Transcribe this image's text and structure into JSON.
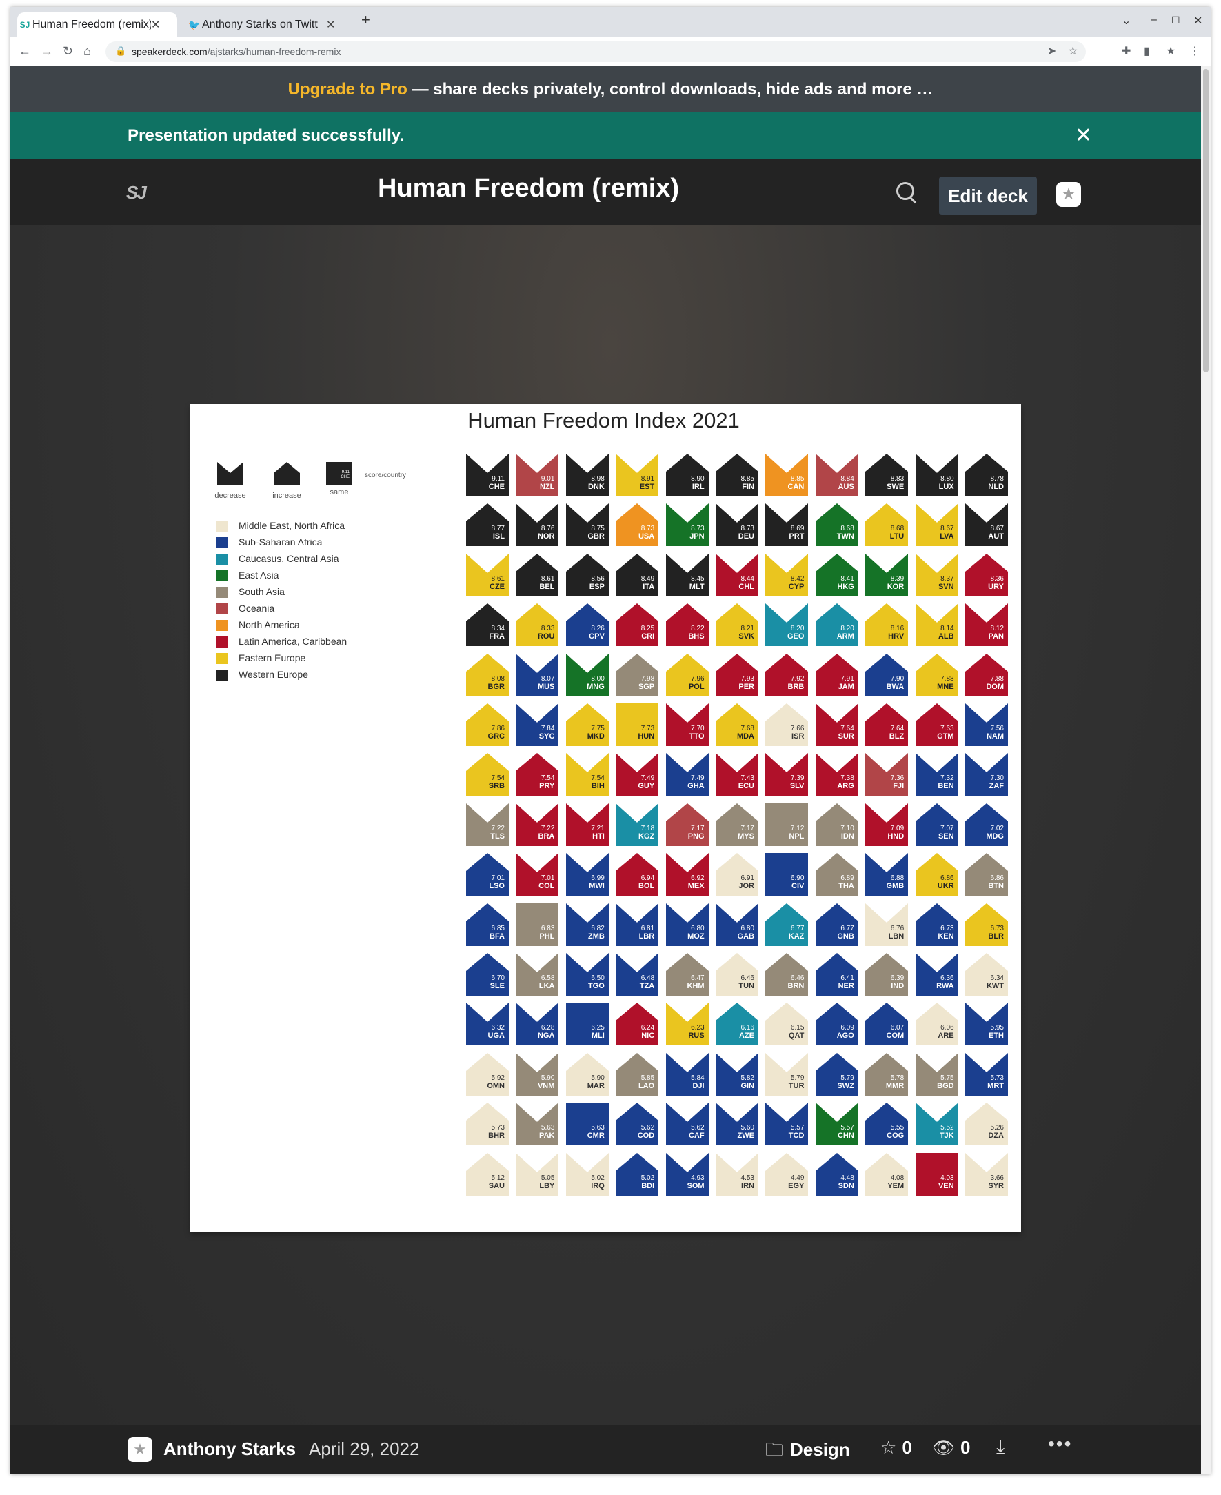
{
  "browser": {
    "tabs": [
      {
        "title": "Human Freedom (remix)",
        "favicon": "speakerdeck-favicon",
        "active": true
      },
      {
        "title": "Anthony Starks on Twitt",
        "favicon": "twitter-favicon",
        "active": false
      }
    ],
    "url_host": "speakerdeck.com",
    "url_path": "/ajstarks/human-freedom-remix"
  },
  "promo": {
    "highlight": "Upgrade to Pro",
    "rest": " — share decks privately, control downloads, hide ads and more …"
  },
  "flash": {
    "message": "Presentation updated successfully."
  },
  "header": {
    "logo": "SJ",
    "title": "Human Freedom (remix)",
    "edit_label": "Edit deck"
  },
  "slide": {
    "title": "Human Freedom Index 2021",
    "key": [
      {
        "shape": "decrease",
        "label": "decrease"
      },
      {
        "shape": "increase",
        "label": "increase"
      },
      {
        "shape": "same",
        "label": "same",
        "sample_score": "9.11",
        "sample_code": "CHE"
      }
    ],
    "key_note": "score/country",
    "legend": [
      {
        "name": "Middle East, North Africa",
        "color": "#efe6cf"
      },
      {
        "name": "Sub-Saharan Africa",
        "color": "#1b3f8f"
      },
      {
        "name": "Caucasus, Central Asia",
        "color": "#1a8fa5"
      },
      {
        "name": "East Asia",
        "color": "#157327"
      },
      {
        "name": "South Asia",
        "color": "#958a78"
      },
      {
        "name": "Oceania",
        "color": "#b14548"
      },
      {
        "name": "North America",
        "color": "#ef9321"
      },
      {
        "name": "Latin America, Caribbean",
        "color": "#b0112a"
      },
      {
        "name": "Eastern Europe",
        "color": "#eac51f"
      },
      {
        "name": "Western Europe",
        "color": "#222222"
      }
    ]
  },
  "chart_data": {
    "type": "table",
    "title": "Human Freedom Index 2021",
    "rows": [
      [
        [
          "9.11",
          "CHE",
          "W",
          "d"
        ],
        [
          "9.01",
          "NZL",
          "O",
          "d"
        ],
        [
          "8.98",
          "DNK",
          "W",
          "d"
        ],
        [
          "8.91",
          "EST",
          "E",
          "d"
        ],
        [
          "8.90",
          "IRL",
          "W",
          "i"
        ],
        [
          "8.85",
          "FIN",
          "W",
          "i"
        ],
        [
          "8.85",
          "CAN",
          "N",
          "d"
        ],
        [
          "8.84",
          "AUS",
          "O",
          "d"
        ],
        [
          "8.83",
          "SWE",
          "W",
          "i"
        ],
        [
          "8.80",
          "LUX",
          "W",
          "d"
        ],
        [
          "8.78",
          "NLD",
          "W",
          "i"
        ]
      ],
      [
        [
          "8.77",
          "ISL",
          "W",
          "i"
        ],
        [
          "8.76",
          "NOR",
          "W",
          "d"
        ],
        [
          "8.75",
          "GBR",
          "W",
          "d"
        ],
        [
          "8.73",
          "USA",
          "N",
          "i"
        ],
        [
          "8.73",
          "JPN",
          "A",
          "d"
        ],
        [
          "8.73",
          "DEU",
          "W",
          "d"
        ],
        [
          "8.69",
          "PRT",
          "W",
          "d"
        ],
        [
          "8.68",
          "TWN",
          "A",
          "i"
        ],
        [
          "8.68",
          "LTU",
          "E",
          "i"
        ],
        [
          "8.67",
          "LVA",
          "E",
          "d"
        ],
        [
          "8.67",
          "AUT",
          "W",
          "d"
        ]
      ],
      [
        [
          "8.61",
          "CZE",
          "E",
          "d"
        ],
        [
          "8.61",
          "BEL",
          "W",
          "i"
        ],
        [
          "8.56",
          "ESP",
          "W",
          "i"
        ],
        [
          "8.49",
          "ITA",
          "W",
          "i"
        ],
        [
          "8.45",
          "MLT",
          "W",
          "d"
        ],
        [
          "8.44",
          "CHL",
          "L",
          "d"
        ],
        [
          "8.42",
          "CYP",
          "E",
          "d"
        ],
        [
          "8.41",
          "HKG",
          "A",
          "i"
        ],
        [
          "8.39",
          "KOR",
          "A",
          "d"
        ],
        [
          "8.37",
          "SVN",
          "E",
          "d"
        ],
        [
          "8.36",
          "URY",
          "L",
          "i"
        ]
      ],
      [
        [
          "8.34",
          "FRA",
          "W",
          "i"
        ],
        [
          "8.33",
          "ROU",
          "E",
          "i"
        ],
        [
          "8.26",
          "CPV",
          "S",
          "i"
        ],
        [
          "8.25",
          "CRI",
          "L",
          "i"
        ],
        [
          "8.22",
          "BHS",
          "L",
          "i"
        ],
        [
          "8.21",
          "SVK",
          "E",
          "i"
        ],
        [
          "8.20",
          "GEO",
          "C",
          "d"
        ],
        [
          "8.20",
          "ARM",
          "C",
          "i"
        ],
        [
          "8.16",
          "HRV",
          "E",
          "i"
        ],
        [
          "8.14",
          "ALB",
          "E",
          "d"
        ],
        [
          "8.12",
          "PAN",
          "L",
          "d"
        ]
      ],
      [
        [
          "8.08",
          "BGR",
          "E",
          "i"
        ],
        [
          "8.07",
          "MUS",
          "S",
          "d"
        ],
        [
          "8.00",
          "MNG",
          "A",
          "d"
        ],
        [
          "7.98",
          "SGP",
          "H",
          "i"
        ],
        [
          "7.96",
          "POL",
          "E",
          "i"
        ],
        [
          "7.93",
          "PER",
          "L",
          "i"
        ],
        [
          "7.92",
          "BRB",
          "L",
          "i"
        ],
        [
          "7.91",
          "JAM",
          "L",
          "i"
        ],
        [
          "7.90",
          "BWA",
          "S",
          "i"
        ],
        [
          "7.88",
          "MNE",
          "E",
          "i"
        ],
        [
          "7.88",
          "DOM",
          "L",
          "i"
        ]
      ],
      [
        [
          "7.86",
          "GRC",
          "E",
          "i"
        ],
        [
          "7.84",
          "SYC",
          "S",
          "d"
        ],
        [
          "7.75",
          "MKD",
          "E",
          "i"
        ],
        [
          "7.73",
          "HUN",
          "E",
          "s"
        ],
        [
          "7.70",
          "TTO",
          "L",
          "d"
        ],
        [
          "7.68",
          "MDA",
          "E",
          "i"
        ],
        [
          "7.66",
          "ISR",
          "M",
          "i"
        ],
        [
          "7.64",
          "SUR",
          "L",
          "d"
        ],
        [
          "7.64",
          "BLZ",
          "L",
          "i"
        ],
        [
          "7.63",
          "GTM",
          "L",
          "i"
        ],
        [
          "7.56",
          "NAM",
          "S",
          "d"
        ]
      ],
      [
        [
          "7.54",
          "SRB",
          "E",
          "i"
        ],
        [
          "7.54",
          "PRY",
          "L",
          "i"
        ],
        [
          "7.54",
          "BIH",
          "E",
          "d"
        ],
        [
          "7.49",
          "GUY",
          "L",
          "d"
        ],
        [
          "7.49",
          "GHA",
          "S",
          "d"
        ],
        [
          "7.43",
          "ECU",
          "L",
          "d"
        ],
        [
          "7.39",
          "SLV",
          "L",
          "d"
        ],
        [
          "7.38",
          "ARG",
          "L",
          "d"
        ],
        [
          "7.36",
          "FJI",
          "O",
          "d"
        ],
        [
          "7.32",
          "BEN",
          "S",
          "d"
        ],
        [
          "7.30",
          "ZAF",
          "S",
          "d"
        ]
      ],
      [
        [
          "7.22",
          "TLS",
          "H",
          "d"
        ],
        [
          "7.22",
          "BRA",
          "L",
          "d"
        ],
        [
          "7.21",
          "HTI",
          "L",
          "d"
        ],
        [
          "7.18",
          "KGZ",
          "C",
          "d"
        ],
        [
          "7.17",
          "PNG",
          "O",
          "i"
        ],
        [
          "7.17",
          "MYS",
          "H",
          "i"
        ],
        [
          "7.12",
          "NPL",
          "H",
          "s"
        ],
        [
          "7.10",
          "IDN",
          "H",
          "i"
        ],
        [
          "7.09",
          "HND",
          "L",
          "d"
        ],
        [
          "7.07",
          "SEN",
          "S",
          "i"
        ],
        [
          "7.02",
          "MDG",
          "S",
          "i"
        ]
      ],
      [
        [
          "7.01",
          "LSO",
          "S",
          "i"
        ],
        [
          "7.01",
          "COL",
          "L",
          "d"
        ],
        [
          "6.99",
          "MWI",
          "S",
          "d"
        ],
        [
          "6.94",
          "BOL",
          "L",
          "i"
        ],
        [
          "6.92",
          "MEX",
          "L",
          "d"
        ],
        [
          "6.91",
          "JOR",
          "M",
          "i"
        ],
        [
          "6.90",
          "CIV",
          "S",
          "s"
        ],
        [
          "6.89",
          "THA",
          "H",
          "i"
        ],
        [
          "6.88",
          "GMB",
          "S",
          "d"
        ],
        [
          "6.86",
          "UKR",
          "E",
          "i"
        ],
        [
          "6.86",
          "BTN",
          "H",
          "i"
        ]
      ],
      [
        [
          "6.85",
          "BFA",
          "S",
          "i"
        ],
        [
          "6.83",
          "PHL",
          "H",
          "s"
        ],
        [
          "6.82",
          "ZMB",
          "S",
          "d"
        ],
        [
          "6.81",
          "LBR",
          "S",
          "d"
        ],
        [
          "6.80",
          "MOZ",
          "S",
          "d"
        ],
        [
          "6.80",
          "GAB",
          "S",
          "d"
        ],
        [
          "6.77",
          "KAZ",
          "C",
          "i"
        ],
        [
          "6.77",
          "GNB",
          "S",
          "i"
        ],
        [
          "6.76",
          "LBN",
          "M",
          "d"
        ],
        [
          "6.73",
          "KEN",
          "S",
          "i"
        ],
        [
          "6.73",
          "BLR",
          "E",
          "i"
        ]
      ],
      [
        [
          "6.70",
          "SLE",
          "S",
          "i"
        ],
        [
          "6.58",
          "LKA",
          "H",
          "d"
        ],
        [
          "6.50",
          "TGO",
          "S",
          "d"
        ],
        [
          "6.48",
          "TZA",
          "S",
          "d"
        ],
        [
          "6.47",
          "KHM",
          "H",
          "i"
        ],
        [
          "6.46",
          "TUN",
          "M",
          "i"
        ],
        [
          "6.46",
          "BRN",
          "H",
          "i"
        ],
        [
          "6.41",
          "NER",
          "S",
          "i"
        ],
        [
          "6.39",
          "IND",
          "H",
          "i"
        ],
        [
          "6.36",
          "RWA",
          "S",
          "d"
        ],
        [
          "6.34",
          "KWT",
          "M",
          "i"
        ]
      ],
      [
        [
          "6.32",
          "UGA",
          "S",
          "d"
        ],
        [
          "6.28",
          "NGA",
          "S",
          "d"
        ],
        [
          "6.25",
          "MLI",
          "S",
          "s"
        ],
        [
          "6.24",
          "NIC",
          "L",
          "i"
        ],
        [
          "6.23",
          "RUS",
          "E",
          "d"
        ],
        [
          "6.16",
          "AZE",
          "C",
          "i"
        ],
        [
          "6.15",
          "QAT",
          "M",
          "i"
        ],
        [
          "6.09",
          "AGO",
          "S",
          "i"
        ],
        [
          "6.07",
          "COM",
          "S",
          "i"
        ],
        [
          "6.06",
          "ARE",
          "M",
          "i"
        ],
        [
          "5.95",
          "ETH",
          "S",
          "d"
        ]
      ],
      [
        [
          "5.92",
          "OMN",
          "M",
          "i"
        ],
        [
          "5.90",
          "VNM",
          "H",
          "d"
        ],
        [
          "5.90",
          "MAR",
          "M",
          "i"
        ],
        [
          "5.85",
          "LAO",
          "H",
          "i"
        ],
        [
          "5.84",
          "DJI",
          "S",
          "d"
        ],
        [
          "5.82",
          "GIN",
          "S",
          "d"
        ],
        [
          "5.79",
          "TUR",
          "M",
          "d"
        ],
        [
          "5.79",
          "SWZ",
          "S",
          "i"
        ],
        [
          "5.78",
          "MMR",
          "H",
          "i"
        ],
        [
          "5.75",
          "BGD",
          "H",
          "d"
        ],
        [
          "5.73",
          "MRT",
          "S",
          "d"
        ]
      ],
      [
        [
          "5.73",
          "BHR",
          "M",
          "i"
        ],
        [
          "5.63",
          "PAK",
          "H",
          "d"
        ],
        [
          "5.63",
          "CMR",
          "S",
          "s"
        ],
        [
          "5.62",
          "COD",
          "S",
          "i"
        ],
        [
          "5.62",
          "CAF",
          "S",
          "d"
        ],
        [
          "5.60",
          "ZWE",
          "S",
          "d"
        ],
        [
          "5.57",
          "TCD",
          "S",
          "d"
        ],
        [
          "5.57",
          "CHN",
          "A",
          "d"
        ],
        [
          "5.55",
          "COG",
          "S",
          "i"
        ],
        [
          "5.52",
          "TJK",
          "C",
          "d"
        ],
        [
          "5.26",
          "DZA",
          "M",
          "i"
        ]
      ],
      [
        [
          "5.12",
          "SAU",
          "M",
          "i"
        ],
        [
          "5.05",
          "LBY",
          "M",
          "d"
        ],
        [
          "5.02",
          "IRQ",
          "M",
          "d"
        ],
        [
          "5.02",
          "BDI",
          "S",
          "i"
        ],
        [
          "4.93",
          "SOM",
          "S",
          "d"
        ],
        [
          "4.53",
          "IRN",
          "M",
          "d"
        ],
        [
          "4.49",
          "EGY",
          "M",
          "i"
        ],
        [
          "4.48",
          "SDN",
          "S",
          "i"
        ],
        [
          "4.08",
          "YEM",
          "M",
          "i"
        ],
        [
          "4.03",
          "VEN",
          "L",
          "s"
        ],
        [
          "3.66",
          "SYR",
          "M",
          "d"
        ]
      ]
    ],
    "region_colors": {
      "M": "#efe6cf",
      "S": "#1b3f8f",
      "C": "#1a8fa5",
      "A": "#157327",
      "H": "#958a78",
      "O": "#b14548",
      "N": "#ef9321",
      "L": "#b0112a",
      "E": "#eac51f",
      "W": "#222222"
    },
    "region_text_colors": {
      "M": "#333333",
      "S": "#ffffff",
      "C": "#ffffff",
      "A": "#ffffff",
      "H": "#ffffff",
      "O": "#ffffff",
      "N": "#ffffff",
      "L": "#ffffff",
      "E": "#222222",
      "W": "#ffffff"
    }
  },
  "footer": {
    "author": "Anthony Starks",
    "date": "April 29, 2022",
    "category": "Design",
    "stars": "0",
    "views": "0"
  }
}
